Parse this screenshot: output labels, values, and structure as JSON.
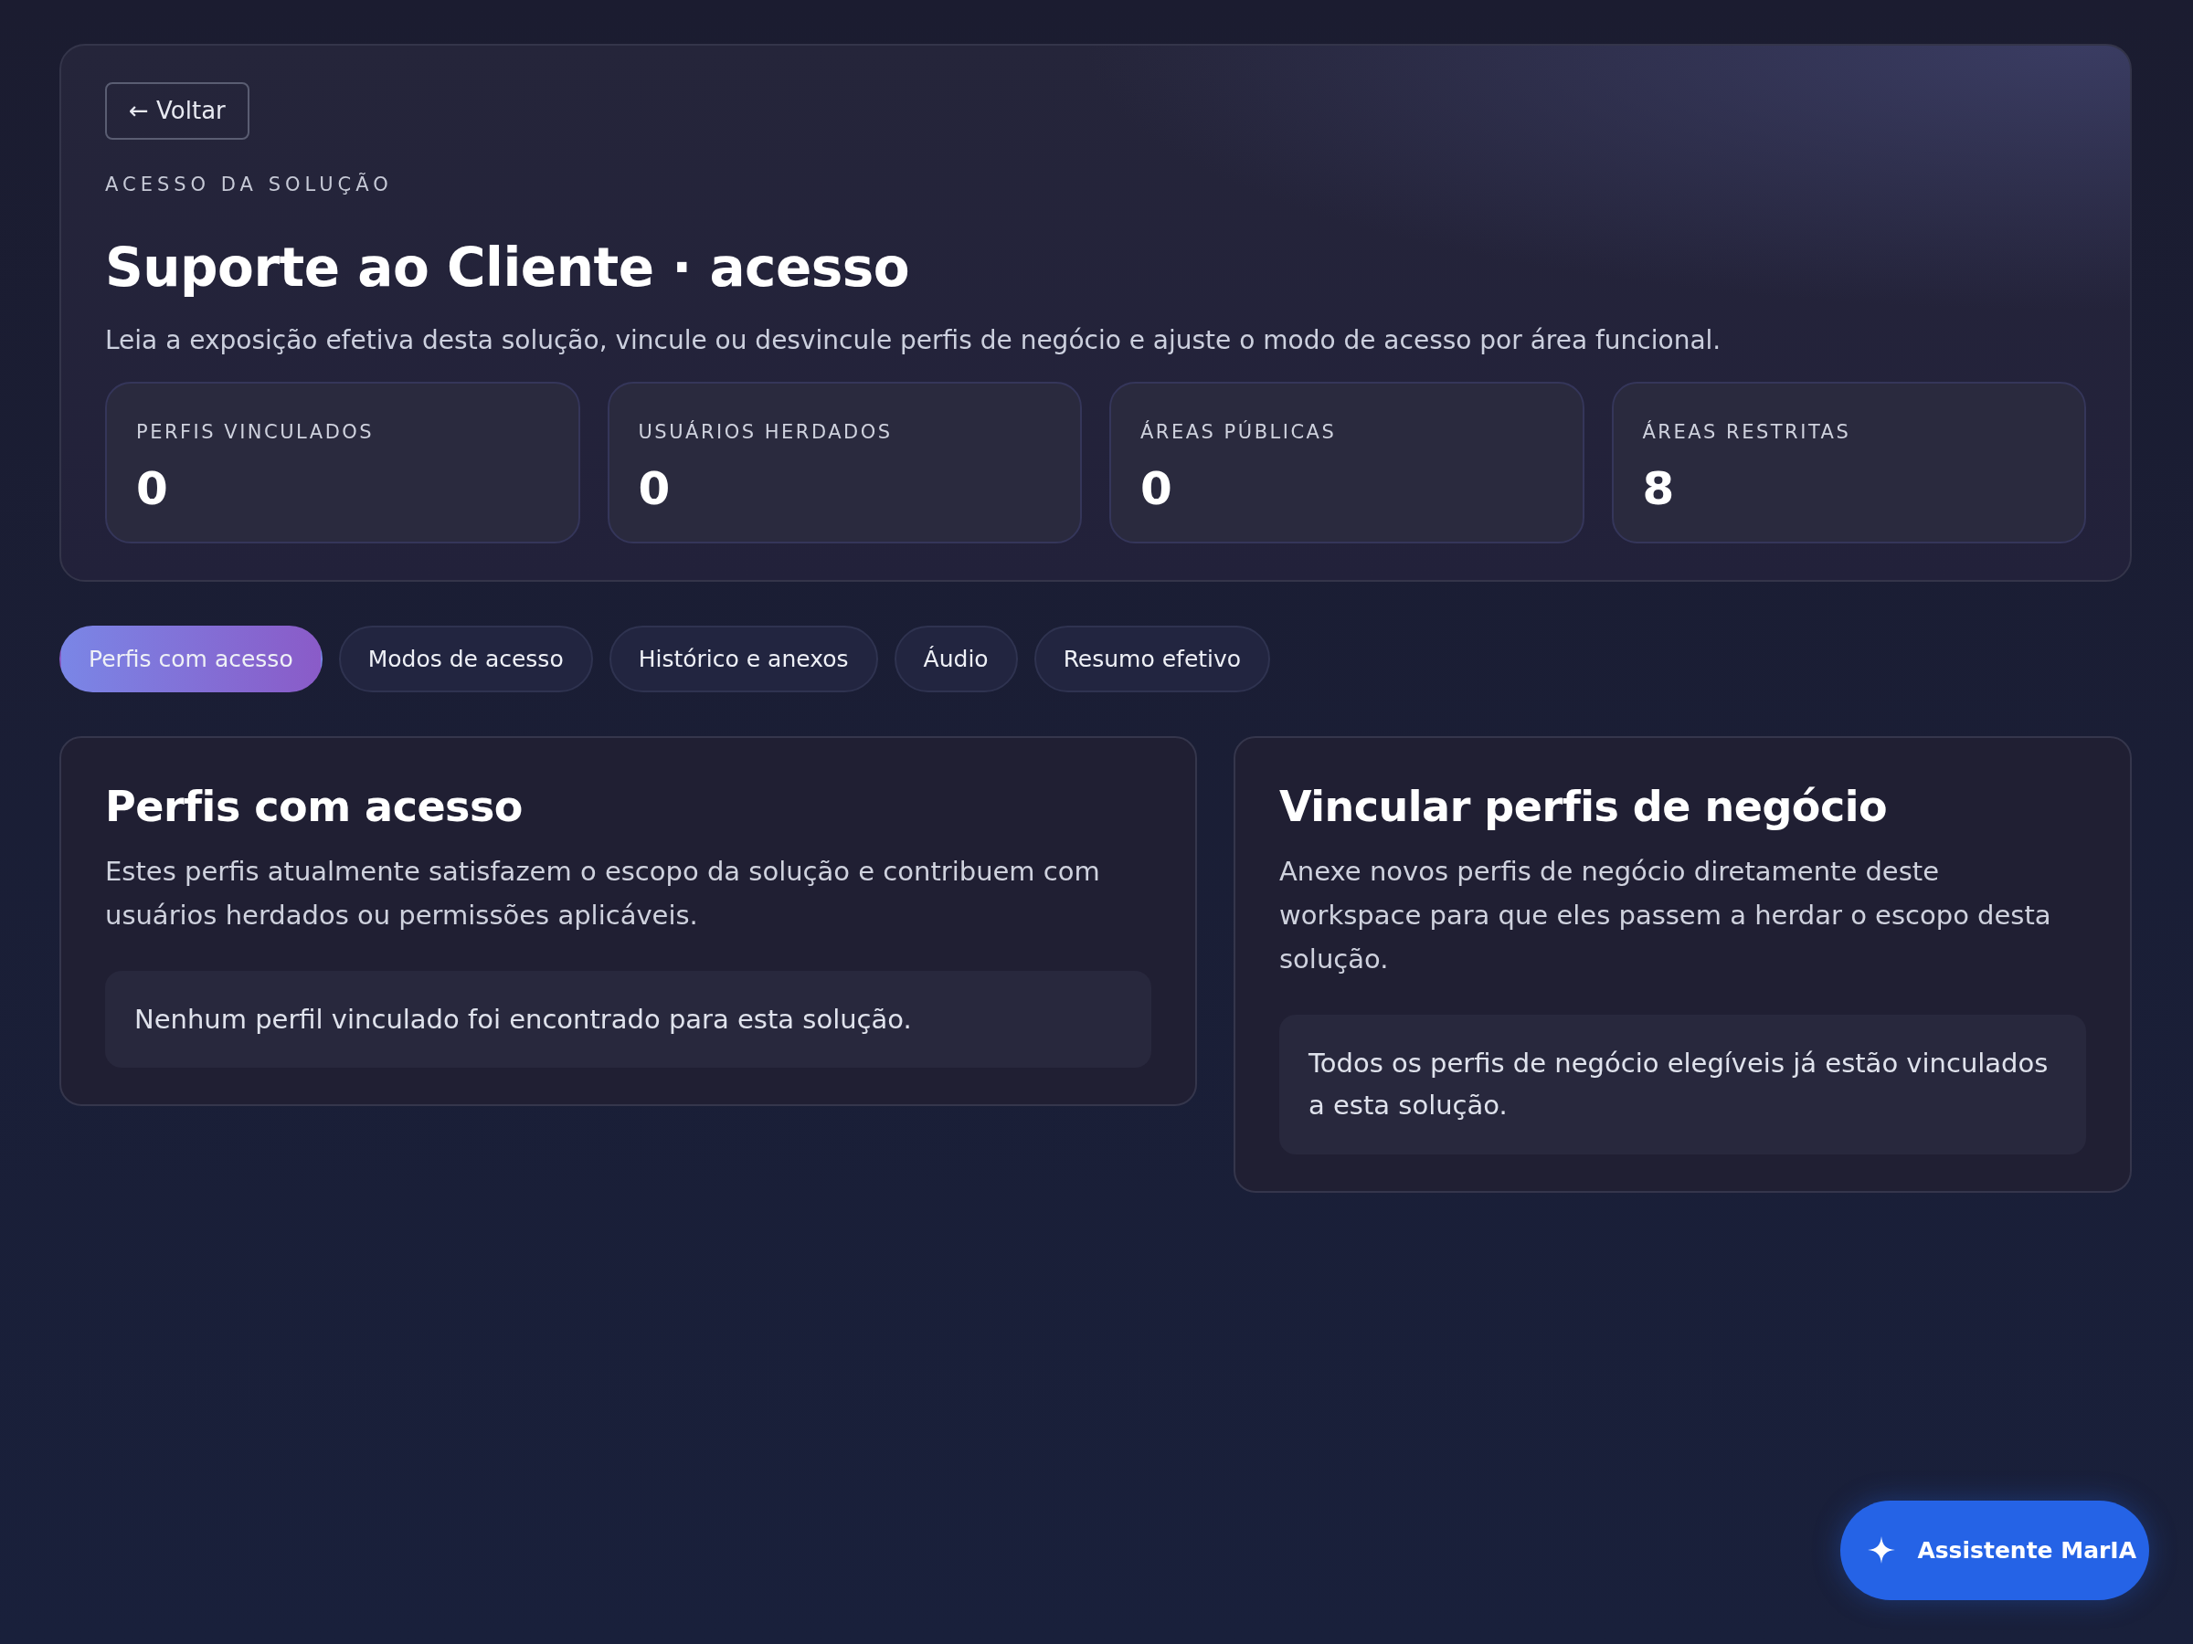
{
  "back_button": {
    "label": "← Voltar"
  },
  "eyebrow": "ACESSO DA SOLUÇÃO",
  "title": "Suporte ao Cliente · acesso",
  "subtitle": "Leia a exposição efetiva desta solução, vincule ou desvincule perfis de negócio e ajuste o modo de acesso por área funcional.",
  "stats": [
    {
      "label": "PERFIS VINCULADOS",
      "value": "0"
    },
    {
      "label": "USUÁRIOS HERDADOS",
      "value": "0"
    },
    {
      "label": "ÁREAS PÚBLICAS",
      "value": "0"
    },
    {
      "label": "ÁREAS RESTRITAS",
      "value": "8"
    }
  ],
  "tabs": [
    {
      "label": "Perfis com acesso",
      "selected": true
    },
    {
      "label": "Modos de acesso",
      "selected": false
    },
    {
      "label": "Histórico e anexos",
      "selected": false
    },
    {
      "label": "Áudio",
      "selected": false
    },
    {
      "label": "Resumo efetivo",
      "selected": false
    }
  ],
  "panels": [
    {
      "title": "Perfis com acesso",
      "description": "Estes perfis atualmente satisfazem o escopo da solução e contribuem com usuários herdados ou permissões aplicáveis.",
      "empty_message": "Nenhum perfil vinculado foi encontrado para esta solução."
    },
    {
      "title": "Vincular perfis de negócio",
      "description": "Anexe novos perfis de negócio diretamente deste workspace para que eles passem a herdar o escopo desta solução.",
      "empty_message": "Todos os perfis de negócio elegíveis já estão vinculados a esta solução."
    }
  ],
  "assistant_button": {
    "label": "Assistente MarIA"
  }
}
